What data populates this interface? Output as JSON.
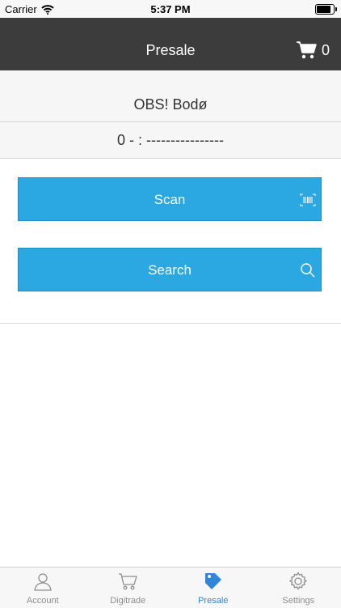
{
  "status_bar": {
    "carrier": "Carrier",
    "time": "5:37 PM",
    "battery_level": 0.95
  },
  "nav": {
    "title": "Presale",
    "cart_count": "0"
  },
  "store": {
    "name": "OBS! Bodø",
    "code": "0 - : ----------------"
  },
  "actions": {
    "scan_label": "Scan",
    "search_label": "Search"
  },
  "tabs": [
    {
      "label": "Account",
      "icon": "person-icon"
    },
    {
      "label": "Digitrade",
      "icon": "cart-icon"
    },
    {
      "label": "Presale",
      "icon": "tag-icon",
      "active": true
    },
    {
      "label": "Settings",
      "icon": "gear-icon"
    }
  ],
  "colors": {
    "nav_bg": "#3c3c3c",
    "button_bg": "#2ba7e2",
    "tab_active": "#2f86d8"
  }
}
